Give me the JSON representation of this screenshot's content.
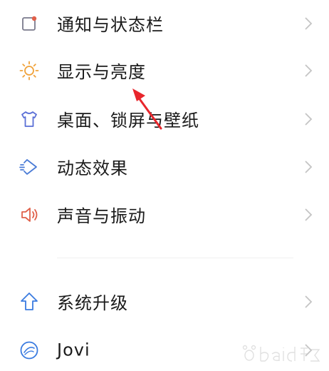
{
  "settings": {
    "items": [
      {
        "label": "通知与状态栏",
        "icon": "notification-square-icon",
        "color": "#7a7a8c"
      },
      {
        "label": "显示与亮度",
        "icon": "sun-icon",
        "color": "#f0a23a"
      },
      {
        "label": "桌面、锁屏与壁纸",
        "icon": "tshirt-icon",
        "color": "#5a6fd6"
      },
      {
        "label": "动态效果",
        "icon": "motion-diamond-icon",
        "color": "#4a7bd6"
      },
      {
        "label": "声音与振动",
        "icon": "speaker-icon",
        "color": "#e0604a"
      },
      {
        "label": "系统升级",
        "icon": "up-arrow-icon",
        "color": "#3a7be0"
      },
      {
        "label": "Jovi",
        "icon": "jovi-icon",
        "color": "#3a7be0"
      }
    ]
  },
  "colors": {
    "text": "#1a1a1a",
    "chevron": "#c4c4c4",
    "annotation_arrow": "#e8262c",
    "divider": "#f0f0f0"
  }
}
